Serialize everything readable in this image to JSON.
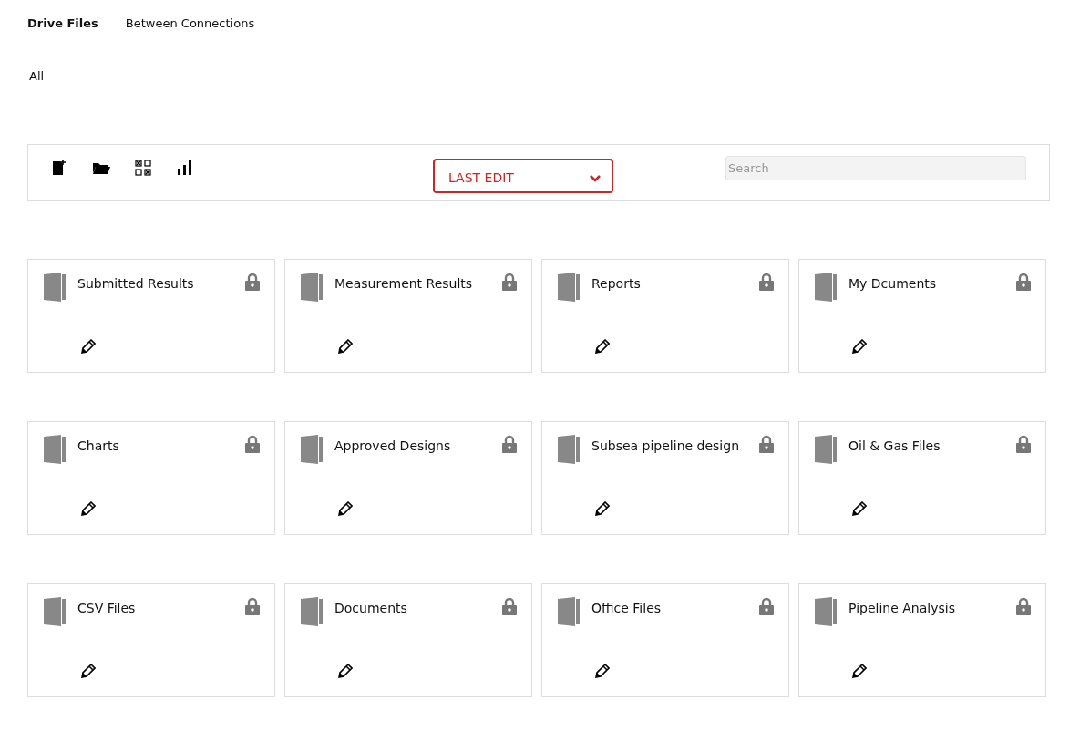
{
  "tabs": [
    {
      "label": "Drive Files",
      "selected": true
    },
    {
      "label": "Between Connections",
      "selected": false
    }
  ],
  "filter": {
    "label": "All"
  },
  "toolbar": {
    "sort": {
      "label": "LAST EDIT"
    },
    "search": {
      "placeholder": "Search"
    }
  },
  "folders": [
    {
      "name": "Submitted Results",
      "locked": true
    },
    {
      "name": "Measurement Results",
      "locked": true
    },
    {
      "name": "Reports",
      "locked": true
    },
    {
      "name": "My Dcuments",
      "locked": true
    },
    {
      "name": "Charts",
      "locked": true
    },
    {
      "name": "Approved Designs",
      "locked": true
    },
    {
      "name": "Subsea pipeline design",
      "locked": true
    },
    {
      "name": "Oil & Gas Files",
      "locked": true
    },
    {
      "name": "CSV Files",
      "locked": true
    },
    {
      "name": "Documents",
      "locked": true
    },
    {
      "name": "Office Files",
      "locked": true
    },
    {
      "name": "Pipeline Analysis",
      "locked": true
    }
  ]
}
